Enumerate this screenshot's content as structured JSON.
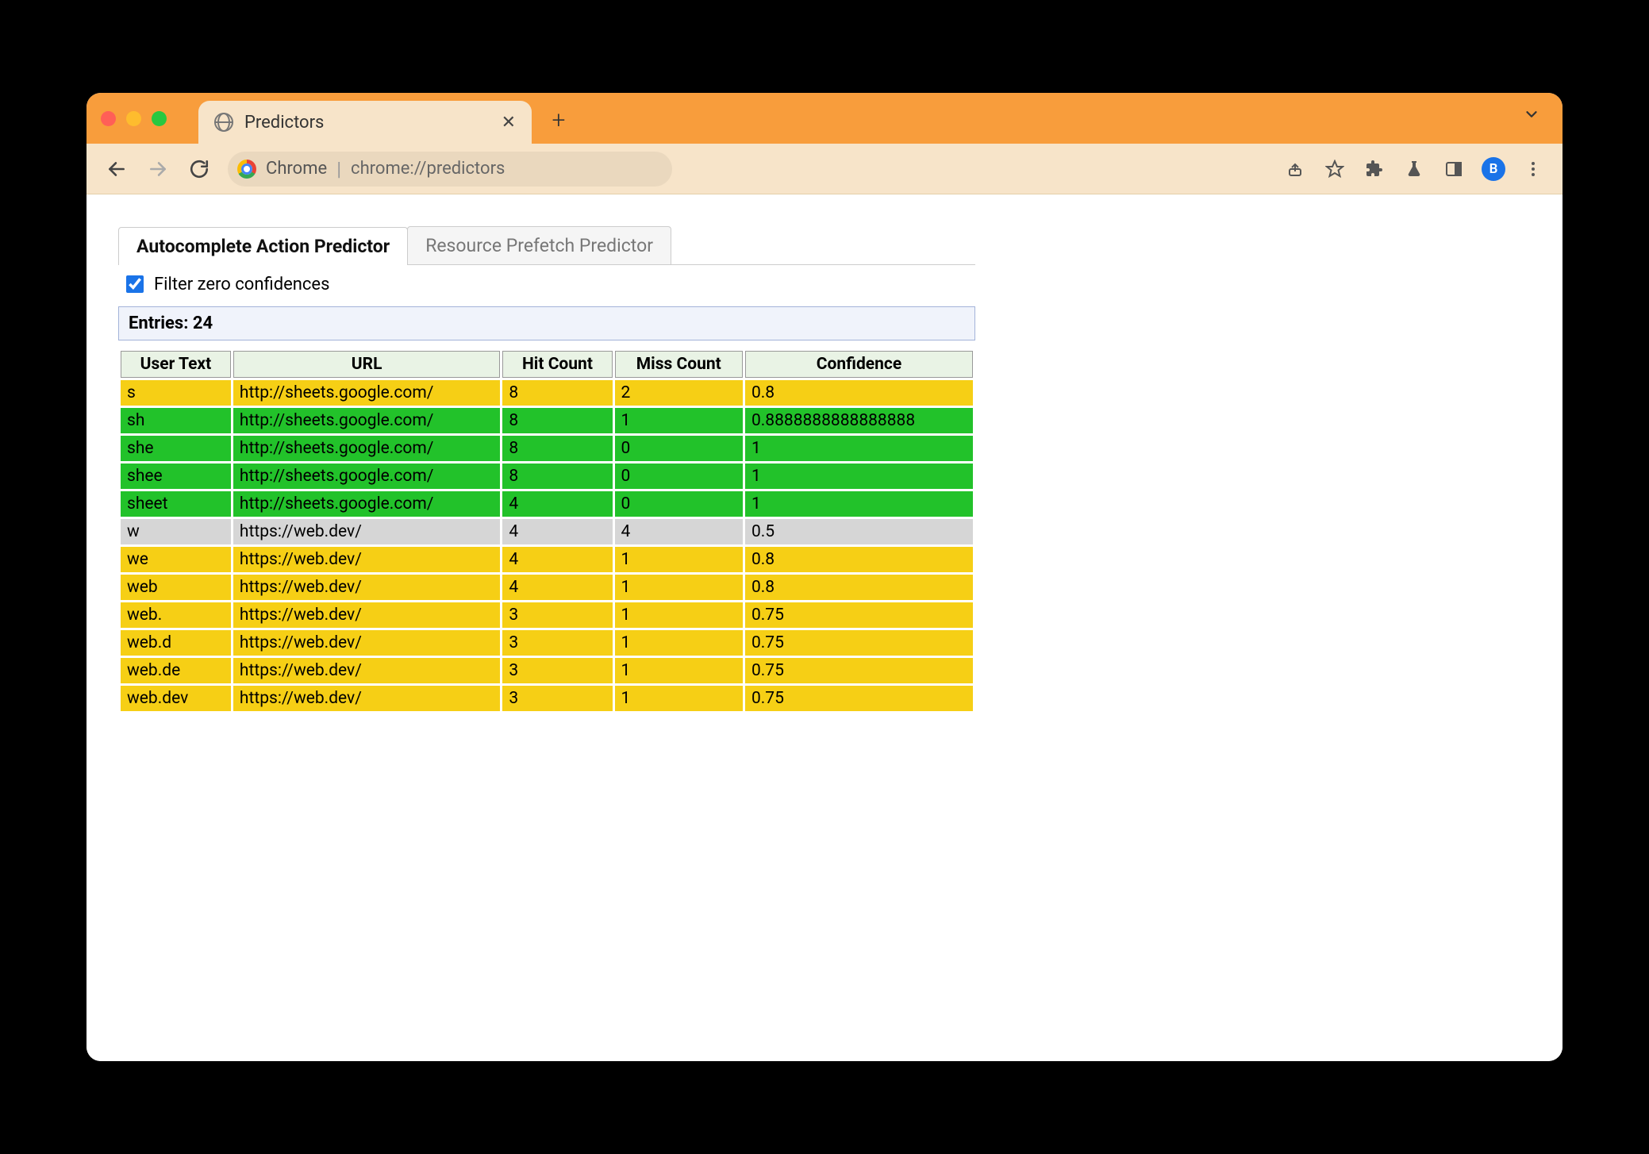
{
  "browser": {
    "tab_title": "Predictors",
    "url_label": "Chrome",
    "url_path": "chrome://predictors",
    "avatar_initial": "B"
  },
  "tabs": {
    "active": "Autocomplete Action Predictor",
    "inactive": "Resource Prefetch Predictor"
  },
  "filter": {
    "label": "Filter zero confidences",
    "checked": true
  },
  "entries": {
    "prefix": "Entries: ",
    "count": "24"
  },
  "columns": {
    "user_text": "User Text",
    "url": "URL",
    "hit": "Hit Count",
    "miss": "Miss Count",
    "confidence": "Confidence"
  },
  "rows": [
    {
      "user_text": "s",
      "url": "http://sheets.google.com/",
      "hit": "8",
      "miss": "2",
      "confidence": "0.8",
      "color": "yellow"
    },
    {
      "user_text": "sh",
      "url": "http://sheets.google.com/",
      "hit": "8",
      "miss": "1",
      "confidence": "0.8888888888888888",
      "color": "green"
    },
    {
      "user_text": "she",
      "url": "http://sheets.google.com/",
      "hit": "8",
      "miss": "0",
      "confidence": "1",
      "color": "green"
    },
    {
      "user_text": "shee",
      "url": "http://sheets.google.com/",
      "hit": "8",
      "miss": "0",
      "confidence": "1",
      "color": "green"
    },
    {
      "user_text": "sheet",
      "url": "http://sheets.google.com/",
      "hit": "4",
      "miss": "0",
      "confidence": "1",
      "color": "green"
    },
    {
      "user_text": "w",
      "url": "https://web.dev/",
      "hit": "4",
      "miss": "4",
      "confidence": "0.5",
      "color": "grey"
    },
    {
      "user_text": "we",
      "url": "https://web.dev/",
      "hit": "4",
      "miss": "1",
      "confidence": "0.8",
      "color": "yellow"
    },
    {
      "user_text": "web",
      "url": "https://web.dev/",
      "hit": "4",
      "miss": "1",
      "confidence": "0.8",
      "color": "yellow"
    },
    {
      "user_text": "web.",
      "url": "https://web.dev/",
      "hit": "3",
      "miss": "1",
      "confidence": "0.75",
      "color": "yellow"
    },
    {
      "user_text": "web.d",
      "url": "https://web.dev/",
      "hit": "3",
      "miss": "1",
      "confidence": "0.75",
      "color": "yellow"
    },
    {
      "user_text": "web.de",
      "url": "https://web.dev/",
      "hit": "3",
      "miss": "1",
      "confidence": "0.75",
      "color": "yellow"
    },
    {
      "user_text": "web.dev",
      "url": "https://web.dev/",
      "hit": "3",
      "miss": "1",
      "confidence": "0.75",
      "color": "yellow"
    }
  ]
}
